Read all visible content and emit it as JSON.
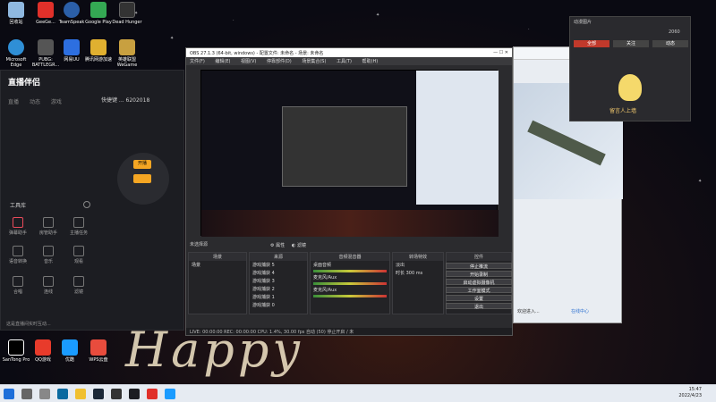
{
  "desktop": {
    "icons_left": [
      {
        "label": "回收站",
        "color": "#8fb8e0"
      },
      {
        "label": "Microsoft Edge",
        "color": "#2f8fd6"
      },
      {
        "label": "直播伴侣",
        "color": "#f2f2f2"
      }
    ],
    "icons_col2": [
      {
        "label": "GeeGe...",
        "color": "#e0302a"
      },
      {
        "label": "PUBG: BATTLEGR...",
        "color": "#444"
      }
    ],
    "icons_col3": [
      {
        "label": "TeamSpeak",
        "color": "#2b5fa8"
      },
      {
        "label": "网易UU",
        "color": "#2d6fe0"
      }
    ],
    "icons_col4": [
      {
        "label": "Google Play",
        "color": "#34a853"
      },
      {
        "label": "腾讯网游加速",
        "color": "#2c7fe0"
      }
    ],
    "icons_col5": [
      {
        "label": "Dead Hunger",
        "color": "#333"
      },
      {
        "label": "英雄联盟WeGame",
        "color": "#e0b030"
      }
    ],
    "icons_bottom": [
      {
        "label": "CapCut",
        "color": "#000"
      },
      {
        "label": "QQ游戏",
        "color": "#e83b2b"
      },
      {
        "label": "优酷",
        "color": "#1a9bff"
      },
      {
        "label": "WPS云盘",
        "color": "#e84c3d"
      }
    ],
    "bottom_label_small": "SanTong Pro"
  },
  "helper": {
    "app_name": "直播伴侣",
    "tabs": [
      "直播",
      "动态",
      "游戏"
    ],
    "status_line": "快捷键 ... 6202018",
    "start_button": "开播",
    "tools_title": "工具库",
    "tools": [
      "弹幕助手",
      "房管助手",
      "主播任务",
      "语音转换",
      "音乐",
      "观看",
      "合唱",
      "连线",
      "滤镜"
    ],
    "footer": "这是直播间实时互动..."
  },
  "obs": {
    "window_title": "OBS 27.1.3 (64-bit, windows) - 配置文件: 未命名 - 场景: 未命名",
    "menu": [
      "文件(F)",
      "编辑(E)",
      "视图(V)",
      "停靠部件(D)",
      "场景集合(S)",
      "工具(T)",
      "帮助(H)"
    ],
    "scene_label": "未选择源",
    "btn_props": "属性",
    "btn_filters": "滤镜",
    "docks": {
      "scenes": {
        "title": "场景",
        "items": [
          "场景"
        ]
      },
      "sources": {
        "title": "来源",
        "items": [
          "游戏捕获 5",
          "游戏捕获 4",
          "游戏捕获 3",
          "游戏捕获 2",
          "游戏捕获 1",
          "游戏捕获 0"
        ]
      },
      "mixer": {
        "title": "音频混音器",
        "items": [
          "桌面音频",
          "麦克风/Aux",
          "麦克风/Aux"
        ]
      },
      "transitions": {
        "title": "转场特效",
        "fade": "淡出",
        "duration_label": "时长",
        "duration": "300 ms"
      },
      "controls": {
        "title": "控件",
        "buttons": [
          "停止推流",
          "开始录制",
          "启动虚拟摄像机",
          "工作室模式",
          "设置",
          "退出"
        ]
      }
    },
    "status": "LIVE: 00:00:00   REC: 00:00:00   CPU: 1.4%, 30.00 fps   自动 (50) 停止开启 / 未"
  },
  "popup": {
    "header_left": "动漫图片",
    "stats": "2060",
    "tabs": [
      "全部",
      "关注",
      "动态"
    ],
    "caption": "留言人上墙"
  },
  "browser": {
    "chat_hint": "欢迎进入...",
    "footer_item": "在线中心"
  },
  "taskbar": {
    "time": "15:47",
    "date": "2022/4/23"
  },
  "background_text": "Happy"
}
